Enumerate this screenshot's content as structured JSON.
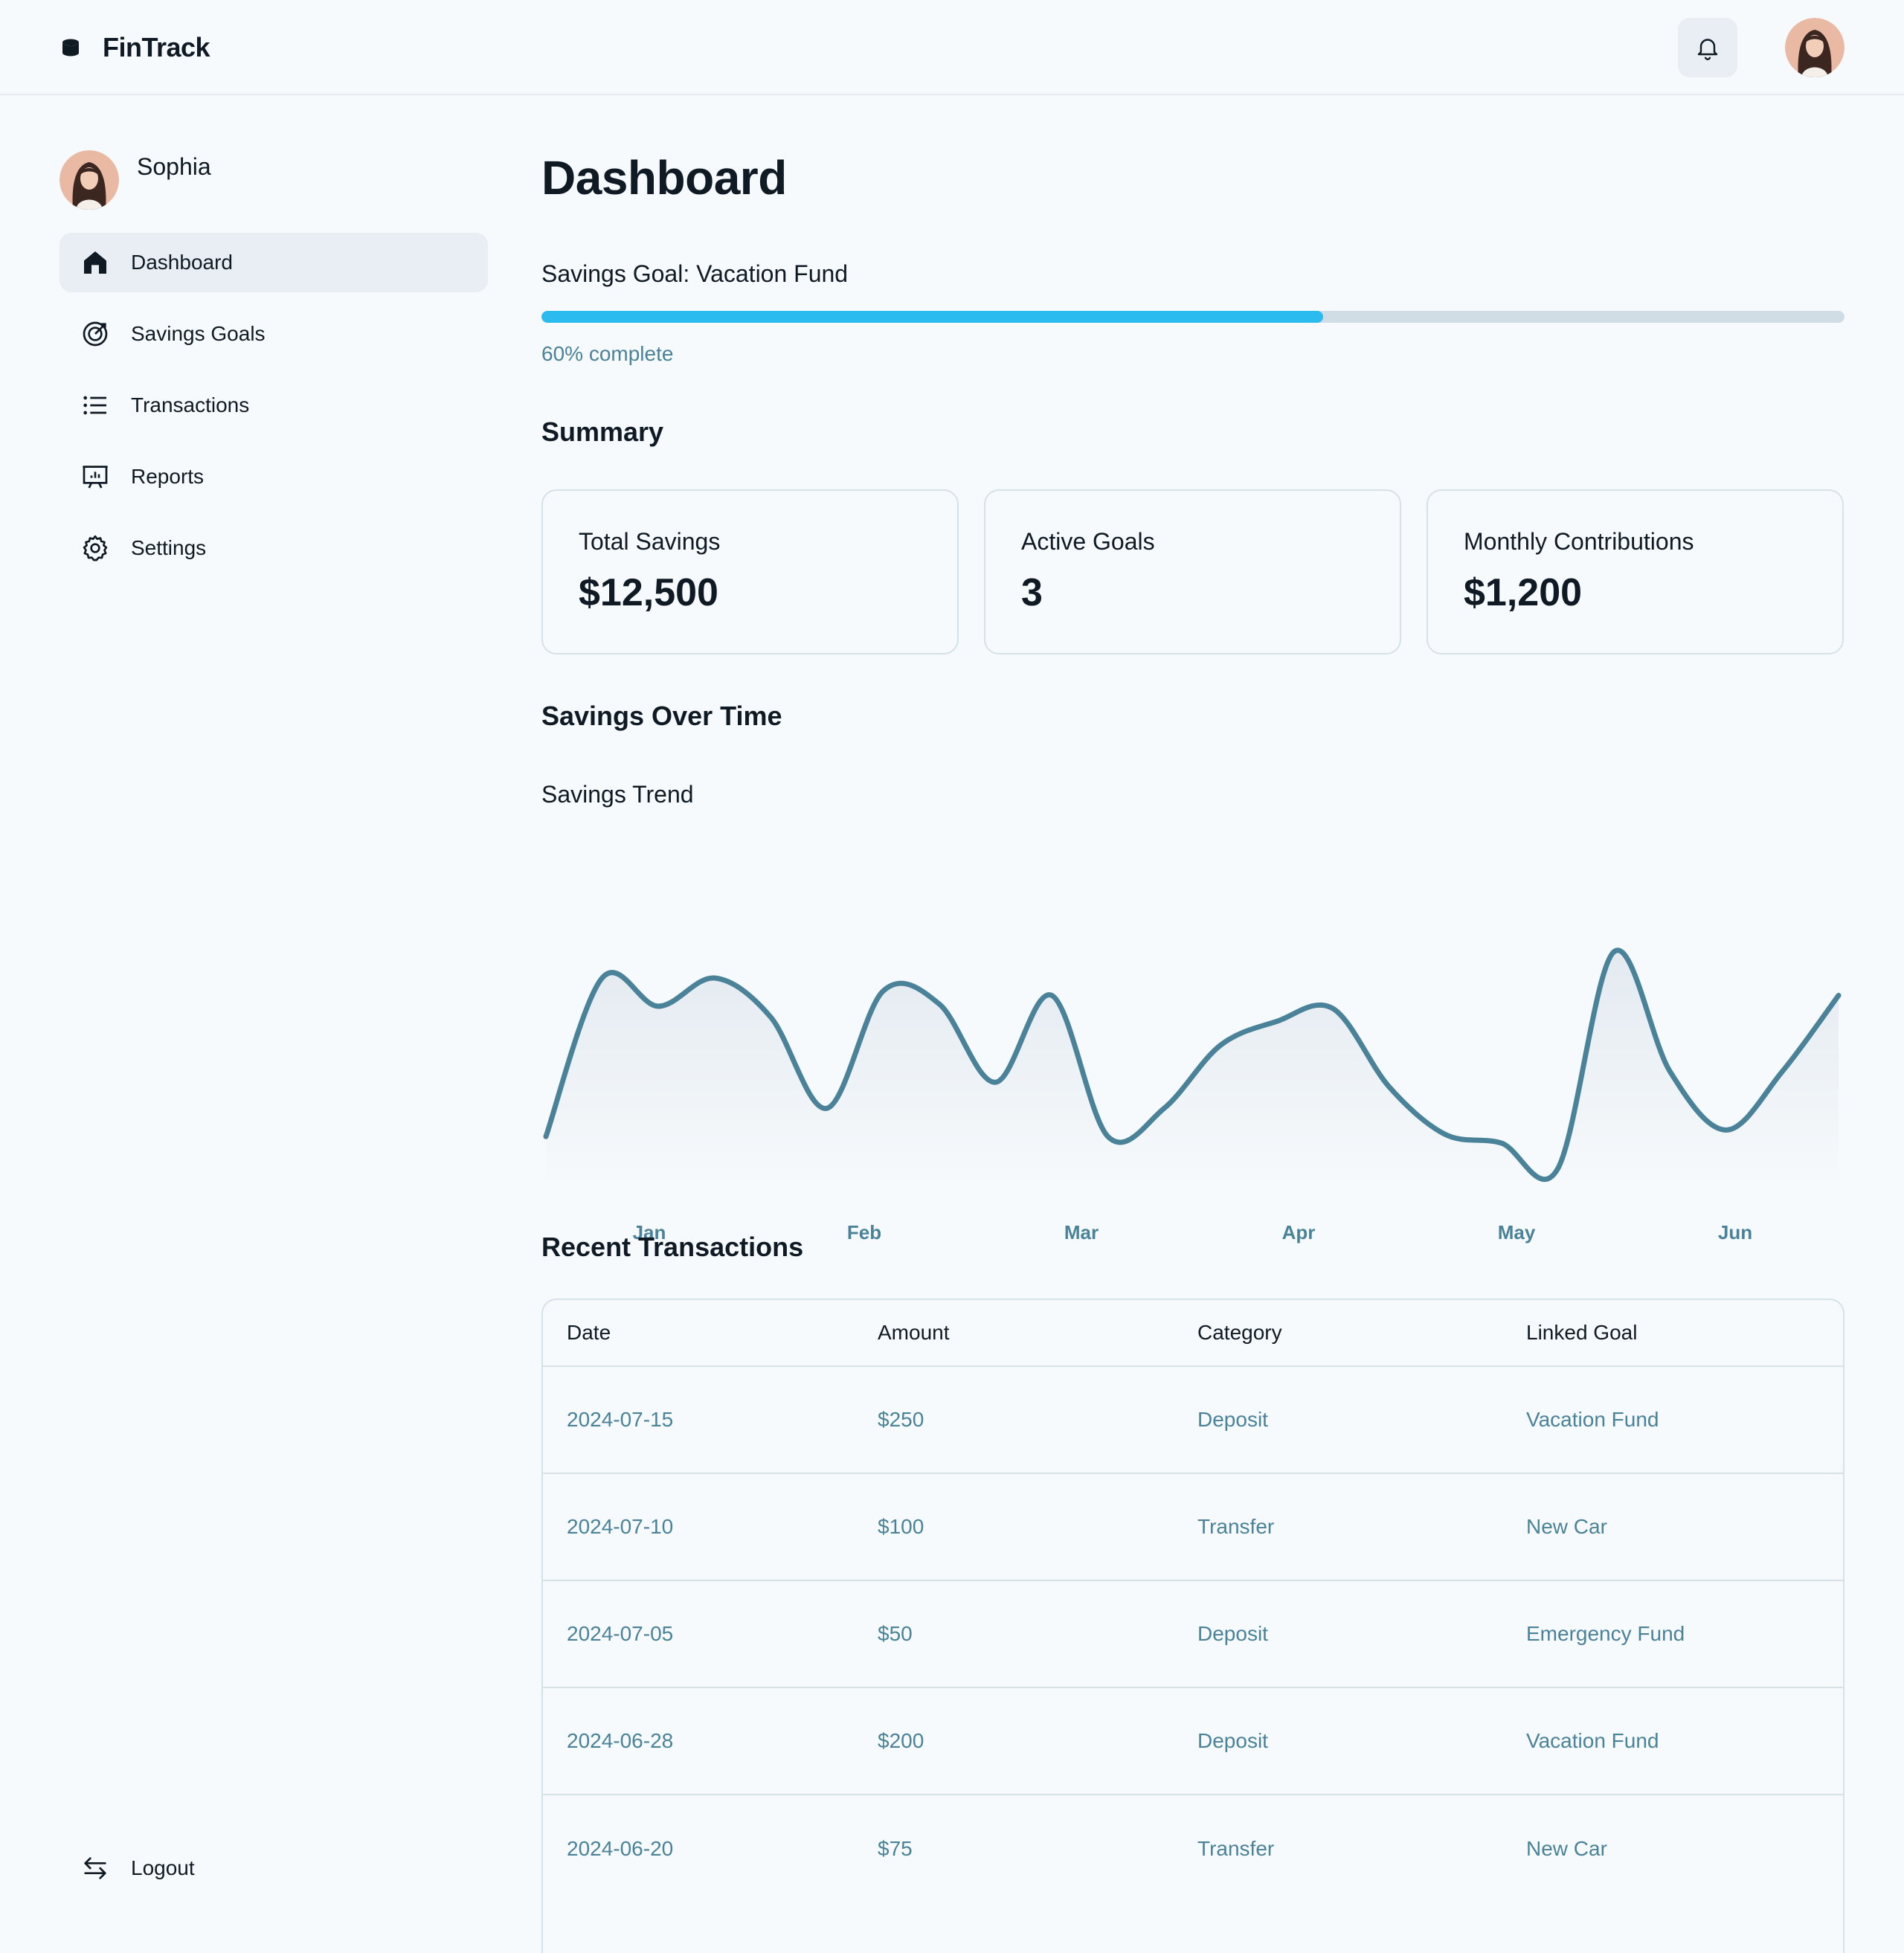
{
  "app": {
    "name": "FinTrack"
  },
  "user": {
    "name": "Sophia"
  },
  "sidebar": {
    "items": [
      {
        "label": "Dashboard",
        "icon": "home-icon",
        "active": true
      },
      {
        "label": "Savings Goals",
        "icon": "target-icon",
        "active": false
      },
      {
        "label": "Transactions",
        "icon": "list-icon",
        "active": false
      },
      {
        "label": "Reports",
        "icon": "presentation-chart-icon",
        "active": false
      },
      {
        "label": "Settings",
        "icon": "gear-icon",
        "active": false
      }
    ],
    "logout": {
      "label": "Logout",
      "icon": "arrows-swap-icon"
    }
  },
  "header": {
    "notification_icon": "bell-icon",
    "avatar": "user-avatar"
  },
  "main": {
    "title": "Dashboard",
    "goal": {
      "label": "Savings Goal: Vacation Fund",
      "progress": 0.6,
      "progress_text": "60% complete"
    },
    "summary": {
      "title": "Summary",
      "cards": [
        {
          "label": "Total Savings",
          "value": "$12,500"
        },
        {
          "label": "Active Goals",
          "value": "3"
        },
        {
          "label": "Monthly Contributions",
          "value": "$1,200"
        }
      ]
    },
    "savings_over_time": {
      "title": "Savings Over Time",
      "subtitle": "Savings Trend"
    },
    "transactions": {
      "title": "Recent Transactions",
      "columns": [
        "Date",
        "Amount",
        "Category",
        "Linked Goal"
      ],
      "rows": [
        [
          "2024-07-15",
          "$250",
          "Deposit",
          "Vacation Fund"
        ],
        [
          "2024-07-10",
          "$100",
          "Transfer",
          "New Car"
        ],
        [
          "2024-07-05",
          "$50",
          "Deposit",
          "Emergency Fund"
        ],
        [
          "2024-06-28",
          "$200",
          "Deposit",
          "Vacation Fund"
        ],
        [
          "2024-06-20",
          "$75",
          "Transfer",
          "New Car"
        ]
      ]
    }
  },
  "colors": {
    "accent": "#2bbbef",
    "line": "#4a8399",
    "muted_text": "#4a8399",
    "active_nav": "#e8eef3"
  },
  "chart_data": {
    "type": "line",
    "title": "Savings Trend",
    "xlabel": "",
    "ylabel": "",
    "categories": [
      "Jan",
      "Feb",
      "Mar",
      "Apr",
      "May",
      "Jun"
    ],
    "values": [
      15,
      88,
      75,
      88,
      70,
      28,
      82,
      76,
      40,
      80,
      15,
      28,
      57,
      68,
      74,
      38,
      16,
      12,
      0,
      100,
      45,
      18,
      45,
      80
    ]
  }
}
